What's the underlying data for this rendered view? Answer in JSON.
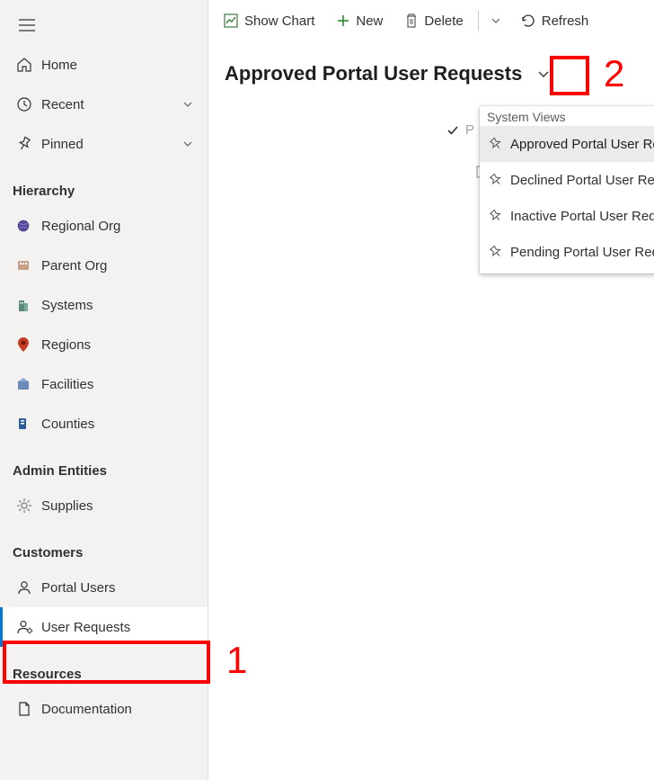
{
  "sidebar": {
    "main": [
      {
        "label": "Home"
      },
      {
        "label": "Recent"
      },
      {
        "label": "Pinned"
      }
    ],
    "sections": {
      "hierarchy": {
        "title": "Hierarchy",
        "items": [
          {
            "label": "Regional Org"
          },
          {
            "label": "Parent Org"
          },
          {
            "label": "Systems"
          },
          {
            "label": "Regions"
          },
          {
            "label": "Facilities"
          },
          {
            "label": "Counties"
          }
        ]
      },
      "admin": {
        "title": "Admin Entities",
        "items": [
          {
            "label": "Supplies"
          }
        ]
      },
      "customers": {
        "title": "Customers",
        "items": [
          {
            "label": "Portal Users"
          },
          {
            "label": "User Requests"
          }
        ]
      },
      "resources": {
        "title": "Resources",
        "items": [
          {
            "label": "Documentation"
          }
        ]
      }
    }
  },
  "commands": {
    "show_chart": "Show Chart",
    "new": "New",
    "delete": "Delete",
    "refresh": "Refresh"
  },
  "view": {
    "title": "Approved Portal User Requests"
  },
  "dropdown": {
    "header": "System Views",
    "items": [
      "Approved Portal User Requests",
      "Declined Portal User Requests",
      "Inactive Portal User Requests",
      "Pending Portal User Requests"
    ]
  },
  "faint_text": "P",
  "annotations": {
    "one": "1",
    "two": "2"
  }
}
